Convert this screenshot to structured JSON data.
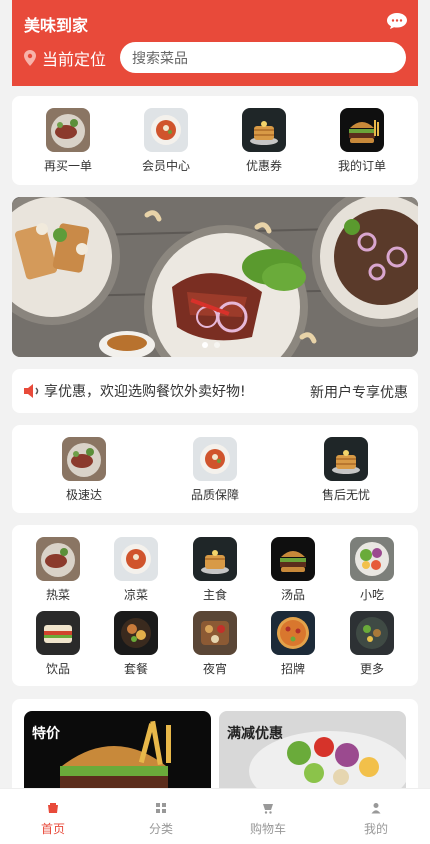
{
  "header": {
    "app_title": "美味到家",
    "location_label": "当前定位",
    "search_placeholder": "搜索菜品"
  },
  "quick_links": [
    {
      "label": "再买一单",
      "icon": "steak-dish-icon"
    },
    {
      "label": "会员中心",
      "icon": "soup-bowl-icon"
    },
    {
      "label": "优惠券",
      "icon": "pancake-stack-icon"
    },
    {
      "label": "我的订单",
      "icon": "burger-icon"
    }
  ],
  "notice": {
    "text": "享优惠，欢迎选购餐饮外卖好物!",
    "right_text": "新用户专享优惠"
  },
  "services": [
    {
      "label": "极速达",
      "icon": "steak-dish-icon"
    },
    {
      "label": "品质保障",
      "icon": "soup-bowl-icon"
    },
    {
      "label": "售后无忧",
      "icon": "pancake-stack-icon"
    }
  ],
  "categories": [
    {
      "label": "热菜",
      "icon": "steak-dish-icon"
    },
    {
      "label": "凉菜",
      "icon": "soup-bowl-icon"
    },
    {
      "label": "主食",
      "icon": "pancake-stack-icon"
    },
    {
      "label": "汤品",
      "icon": "burger-icon"
    },
    {
      "label": "小吃",
      "icon": "salad-icon"
    },
    {
      "label": "饮品",
      "icon": "sandwich-icon"
    },
    {
      "label": "套餐",
      "icon": "platter-icon"
    },
    {
      "label": "夜宵",
      "icon": "bbq-icon"
    },
    {
      "label": "招牌",
      "icon": "pizza-icon"
    },
    {
      "label": "更多",
      "icon": "stirfry-icon"
    }
  ],
  "promos": [
    {
      "title": "特价",
      "icon": "burger-icon"
    },
    {
      "title": "满减优惠",
      "icon": "salad-icon"
    }
  ],
  "tabbar": [
    {
      "label": "首页",
      "icon": "home-icon",
      "active": true
    },
    {
      "label": "分类",
      "icon": "grid-icon",
      "active": false
    },
    {
      "label": "购物车",
      "icon": "cart-icon",
      "active": false
    },
    {
      "label": "我的",
      "icon": "user-icon",
      "active": false
    }
  ],
  "colors": {
    "brand": "#e84a3a",
    "background": "#f2f2f2"
  }
}
